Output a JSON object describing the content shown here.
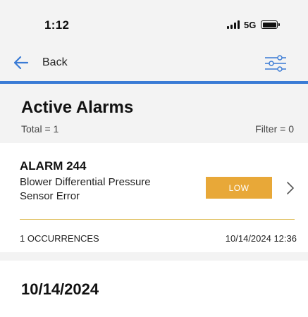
{
  "status_bar": {
    "time": "1:12",
    "network": "5G",
    "battery_level": 1.0
  },
  "nav": {
    "back_label": "Back",
    "back_icon": "arrow-left-icon",
    "filter_icon": "sliders-icon",
    "accent_color": "#3a7bd5"
  },
  "header": {
    "title": "Active Alarms",
    "total": "Total = 1",
    "filter": "Filter = 0"
  },
  "alarms": [
    {
      "code": "ALARM 244",
      "description": "Blower Differential Pressure Sensor Error",
      "severity": "LOW",
      "severity_color": "#e8a838",
      "occurrences": "1 OCCURRENCES",
      "timestamp": "10/14/2024 12:36"
    }
  ],
  "date_section": {
    "date": "10/14/2024"
  }
}
